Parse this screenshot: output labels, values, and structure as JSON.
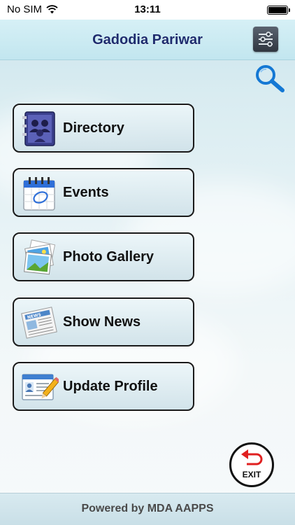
{
  "status_bar": {
    "carrier": "No SIM",
    "time": "13:11",
    "battery_level": 1.0
  },
  "header": {
    "title": "Gadodia Pariwar",
    "settings_icon": "settings-sliders-icon",
    "search_icon": "search-icon"
  },
  "menu": [
    {
      "label": "Directory",
      "icon": "directory-book-icon"
    },
    {
      "label": "Events",
      "icon": "calendar-icon"
    },
    {
      "label": "Photo Gallery",
      "icon": "photo-gallery-icon"
    },
    {
      "label": "Show News",
      "icon": "newspaper-icon"
    },
    {
      "label": "Update Profile",
      "icon": "profile-card-icon"
    }
  ],
  "exit": {
    "label": "EXIT",
    "icon": "exit-arrow-icon"
  },
  "footer": {
    "text": "Powered by MDA AAPPS"
  },
  "colors": {
    "title": "#1e2c6e",
    "search_accent": "#1478d4",
    "exit_arrow": "#e02020",
    "button_border": "#1a1a1a"
  }
}
